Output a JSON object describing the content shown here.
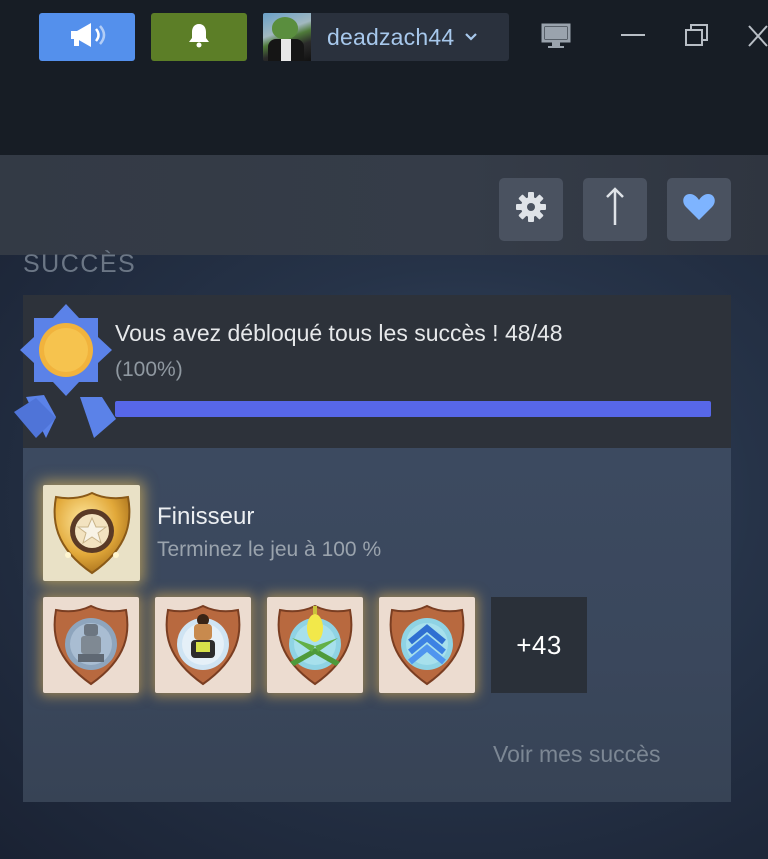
{
  "titlebar": {
    "username": "deadzach44",
    "colors": {
      "announce": "#5490ec",
      "notifications": "#5c7e27",
      "username": "#a7c8ec"
    }
  },
  "section": {
    "label": "SUCCÈS"
  },
  "achievements": {
    "summary_text": "Vous avez débloqué tous les succès ! 48/48",
    "percent_text": "(100%)",
    "progress_fraction": 1.0,
    "featured": {
      "name": "Finisseur",
      "description": "Terminez le jeu à 100 %"
    },
    "more_count": "+43",
    "view_link": "Voir mes succès"
  },
  "icons": {
    "announce": "megaphone-icon",
    "notifications": "bell-icon",
    "settings": "gear-icon",
    "upload": "arrow-up-icon",
    "favorite": "heart-icon"
  }
}
